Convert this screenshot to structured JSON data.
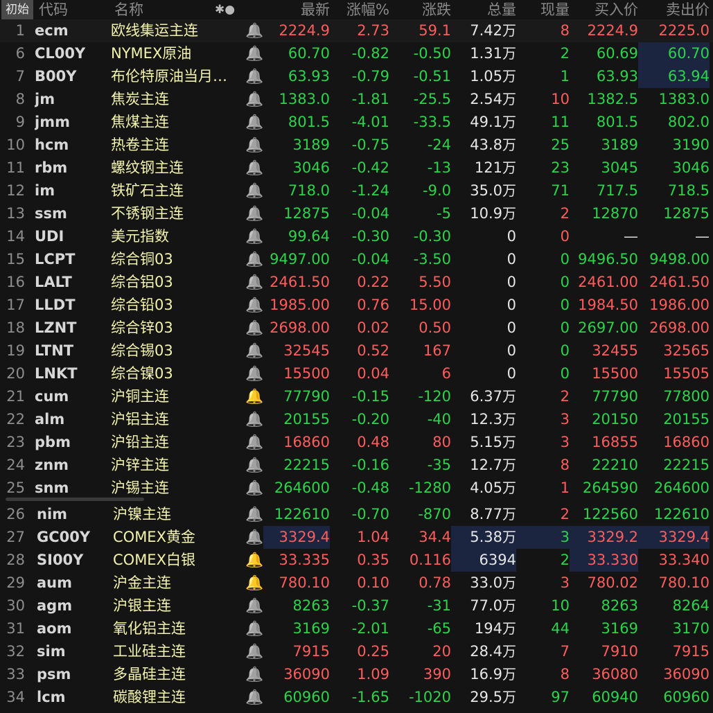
{
  "header": {
    "tag": "初始",
    "code": "代码",
    "name": "名称",
    "settings_glyph": "✱●",
    "latest": "最新",
    "change_pct": "涨幅%",
    "change": "涨跌",
    "total_vol": "总量",
    "cur_vol": "现量",
    "bid": "买入价",
    "ask": "卖出价"
  },
  "rows": [
    {
      "no": "1",
      "code": "ecm",
      "name": "欧线集运主连",
      "bell": false,
      "latest": "2224.9",
      "pct": "2.73",
      "chg": "59.1",
      "vol": "7.42",
      "unit": "万",
      "cur": "8",
      "bid": "2224.9",
      "ask": "2225.0",
      "dir": "up",
      "cur_dir": "up",
      "bid_dir": "up",
      "ask_dir": "up"
    },
    {
      "no": "6",
      "code": "CL00Y",
      "name": "NYMEX原油",
      "bell": false,
      "latest": "60.70",
      "pct": "-0.82",
      "chg": "-0.50",
      "vol": "1.31",
      "unit": "万",
      "cur": "2",
      "bid": "60.69",
      "ask": "60.70",
      "dir": "dn",
      "cur_dir": "dn",
      "bid_dir": "dn",
      "ask_dir": "dn",
      "hl_ask": true
    },
    {
      "no": "7",
      "code": "B00Y",
      "name": "布伦特原油当月…",
      "bell": false,
      "latest": "63.93",
      "pct": "-0.79",
      "chg": "-0.51",
      "vol": "1.05",
      "unit": "万",
      "cur": "1",
      "bid": "63.93",
      "ask": "63.94",
      "dir": "dn",
      "cur_dir": "dn",
      "bid_dir": "dn",
      "ask_dir": "dn",
      "hl_ask": true
    },
    {
      "no": "8",
      "code": "jm",
      "name": "焦炭主连",
      "bell": false,
      "latest": "1383.0",
      "pct": "-1.81",
      "chg": "-25.5",
      "vol": "2.54",
      "unit": "万",
      "cur": "10",
      "bid": "1382.5",
      "ask": "1383.0",
      "dir": "dn",
      "cur_dir": "up",
      "bid_dir": "dn",
      "ask_dir": "dn"
    },
    {
      "no": "9",
      "code": "jmm",
      "name": "焦煤主连",
      "bell": false,
      "latest": "801.5",
      "pct": "-4.01",
      "chg": "-33.5",
      "vol": "49.1",
      "unit": "万",
      "cur": "11",
      "bid": "801.5",
      "ask": "802.0",
      "dir": "dn",
      "cur_dir": "dn",
      "bid_dir": "dn",
      "ask_dir": "dn"
    },
    {
      "no": "10",
      "code": "hcm",
      "name": "热卷主连",
      "bell": false,
      "latest": "3189",
      "pct": "-0.75",
      "chg": "-24",
      "vol": "43.8",
      "unit": "万",
      "cur": "25",
      "bid": "3189",
      "ask": "3190",
      "dir": "dn",
      "cur_dir": "dn",
      "bid_dir": "dn",
      "ask_dir": "dn"
    },
    {
      "no": "11",
      "code": "rbm",
      "name": "螺纹钢主连",
      "bell": false,
      "latest": "3046",
      "pct": "-0.42",
      "chg": "-13",
      "vol": "121",
      "unit": "万",
      "cur": "23",
      "bid": "3045",
      "ask": "3046",
      "dir": "dn",
      "cur_dir": "dn",
      "bid_dir": "dn",
      "ask_dir": "dn"
    },
    {
      "no": "12",
      "code": "im",
      "name": "铁矿石主连",
      "bell": false,
      "latest": "718.0",
      "pct": "-1.24",
      "chg": "-9.0",
      "vol": "35.0",
      "unit": "万",
      "cur": "71",
      "bid": "717.5",
      "ask": "718.5",
      "dir": "dn",
      "cur_dir": "dn",
      "bid_dir": "dn",
      "ask_dir": "dn"
    },
    {
      "no": "13",
      "code": "ssm",
      "name": "不锈钢主连",
      "bell": false,
      "latest": "12875",
      "pct": "-0.04",
      "chg": "-5",
      "vol": "10.9",
      "unit": "万",
      "cur": "2",
      "bid": "12870",
      "ask": "12875",
      "dir": "dn",
      "cur_dir": "up",
      "bid_dir": "dn",
      "ask_dir": "dn"
    },
    {
      "no": "14",
      "code": "UDI",
      "name": "美元指数",
      "bell": false,
      "latest": "99.64",
      "pct": "-0.30",
      "chg": "-0.30",
      "vol": "0",
      "unit": "",
      "cur": "0",
      "bid": "—",
      "ask": "—",
      "dir": "dn",
      "cur_dir": "up",
      "bid_dir": "neu",
      "ask_dir": "neu"
    },
    {
      "no": "15",
      "code": "LCPT",
      "name": "综合铜03",
      "bell": false,
      "latest": "9497.00",
      "pct": "-0.04",
      "chg": "-3.50",
      "vol": "0",
      "unit": "",
      "cur": "0",
      "bid": "9496.50",
      "ask": "9498.00",
      "dir": "dn",
      "cur_dir": "dn",
      "bid_dir": "dn",
      "ask_dir": "dn"
    },
    {
      "no": "16",
      "code": "LALT",
      "name": "综合铝03",
      "bell": false,
      "latest": "2461.50",
      "pct": "0.22",
      "chg": "5.50",
      "vol": "0",
      "unit": "",
      "cur": "0",
      "bid": "2461.00",
      "ask": "2461.50",
      "dir": "up",
      "cur_dir": "dn",
      "bid_dir": "up",
      "ask_dir": "up"
    },
    {
      "no": "17",
      "code": "LLDT",
      "name": "综合铅03",
      "bell": false,
      "latest": "1985.00",
      "pct": "0.76",
      "chg": "15.00",
      "vol": "0",
      "unit": "",
      "cur": "0",
      "bid": "1984.50",
      "ask": "1986.00",
      "dir": "up",
      "cur_dir": "dn",
      "bid_dir": "up",
      "ask_dir": "up"
    },
    {
      "no": "18",
      "code": "LZNT",
      "name": "综合锌03",
      "bell": false,
      "latest": "2698.00",
      "pct": "0.02",
      "chg": "0.50",
      "vol": "0",
      "unit": "",
      "cur": "0",
      "bid": "2697.00",
      "ask": "2698.00",
      "dir": "up",
      "cur_dir": "dn",
      "bid_dir": "dn",
      "ask_dir": "up"
    },
    {
      "no": "19",
      "code": "LTNT",
      "name": "综合锡03",
      "bell": false,
      "latest": "32545",
      "pct": "0.52",
      "chg": "167",
      "vol": "0",
      "unit": "",
      "cur": "0",
      "bid": "32455",
      "ask": "32565",
      "dir": "up",
      "cur_dir": "dn",
      "bid_dir": "up",
      "ask_dir": "up"
    },
    {
      "no": "20",
      "code": "LNKT",
      "name": "综合镍03",
      "bell": false,
      "latest": "15500",
      "pct": "0.04",
      "chg": "6",
      "vol": "0",
      "unit": "",
      "cur": "0",
      "bid": "15500",
      "ask": "15505",
      "dir": "up",
      "cur_dir": "dn",
      "bid_dir": "up",
      "ask_dir": "up"
    },
    {
      "no": "21",
      "code": "cum",
      "name": "沪铜主连",
      "bell": true,
      "latest": "77790",
      "pct": "-0.15",
      "chg": "-120",
      "vol": "6.37",
      "unit": "万",
      "cur": "2",
      "bid": "77790",
      "ask": "77800",
      "dir": "dn",
      "cur_dir": "up",
      "bid_dir": "dn",
      "ask_dir": "dn"
    },
    {
      "no": "22",
      "code": "alm",
      "name": "沪铝主连",
      "bell": false,
      "latest": "20155",
      "pct": "-0.20",
      "chg": "-40",
      "vol": "12.3",
      "unit": "万",
      "cur": "3",
      "bid": "20150",
      "ask": "20155",
      "dir": "dn",
      "cur_dir": "up",
      "bid_dir": "dn",
      "ask_dir": "dn"
    },
    {
      "no": "23",
      "code": "pbm",
      "name": "沪铅主连",
      "bell": false,
      "latest": "16860",
      "pct": "0.48",
      "chg": "80",
      "vol": "5.15",
      "unit": "万",
      "cur": "3",
      "bid": "16855",
      "ask": "16860",
      "dir": "up",
      "cur_dir": "up",
      "bid_dir": "up",
      "ask_dir": "up"
    },
    {
      "no": "24",
      "code": "znm",
      "name": "沪锌主连",
      "bell": false,
      "latest": "22215",
      "pct": "-0.16",
      "chg": "-35",
      "vol": "12.7",
      "unit": "万",
      "cur": "8",
      "bid": "22210",
      "ask": "22215",
      "dir": "dn",
      "cur_dir": "up",
      "bid_dir": "dn",
      "ask_dir": "dn"
    },
    {
      "no": "25",
      "code": "snm",
      "name": "沪锡主连",
      "bell": false,
      "latest": "264600",
      "pct": "-0.48",
      "chg": "-1280",
      "vol": "4.05",
      "unit": "万",
      "cur": "1",
      "bid": "264590",
      "ask": "264600",
      "dir": "dn",
      "cur_dir": "up",
      "bid_dir": "dn",
      "ask_dir": "dn"
    },
    {
      "no": "26",
      "code": "nim",
      "name": "沪镍主连",
      "bell": false,
      "latest": "122610",
      "pct": "-0.70",
      "chg": "-870",
      "vol": "8.77",
      "unit": "万",
      "cur": "2",
      "bid": "122560",
      "ask": "122610",
      "dir": "dn",
      "cur_dir": "up",
      "bid_dir": "dn",
      "ask_dir": "dn"
    },
    {
      "no": "27",
      "code": "GC00Y",
      "name": "COMEX黄金",
      "bell": false,
      "latest": "3329.4",
      "pct": "1.04",
      "chg": "34.4",
      "vol": "5.38",
      "unit": "万",
      "cur": "3",
      "bid": "3329.2",
      "ask": "3329.4",
      "dir": "up",
      "cur_dir": "dn",
      "bid_dir": "up",
      "ask_dir": "up",
      "hl_latest": true,
      "hl_vol": true,
      "hl_cur": true,
      "hl_bid": true,
      "hl_ask": true
    },
    {
      "no": "28",
      "code": "SI00Y",
      "name": "COMEX白银",
      "bell": true,
      "latest": "33.335",
      "pct": "0.35",
      "chg": "0.116",
      "vol": "6394",
      "unit": "",
      "cur": "2",
      "bid": "33.330",
      "ask": "33.340",
      "dir": "up",
      "cur_dir": "dn",
      "bid_dir": "up",
      "ask_dir": "up",
      "hl_vol": true,
      "hl_bid": true
    },
    {
      "no": "29",
      "code": "aum",
      "name": "沪金主连",
      "bell": true,
      "latest": "780.10",
      "pct": "0.10",
      "chg": "0.78",
      "vol": "33.0",
      "unit": "万",
      "cur": "3",
      "bid": "780.02",
      "ask": "780.10",
      "dir": "up",
      "cur_dir": "up",
      "bid_dir": "up",
      "ask_dir": "up"
    },
    {
      "no": "30",
      "code": "agm",
      "name": "沪银主连",
      "bell": false,
      "latest": "8263",
      "pct": "-0.37",
      "chg": "-31",
      "vol": "77.0",
      "unit": "万",
      "cur": "10",
      "bid": "8263",
      "ask": "8264",
      "dir": "dn",
      "cur_dir": "dn",
      "bid_dir": "dn",
      "ask_dir": "dn"
    },
    {
      "no": "31",
      "code": "aom",
      "name": "氧化铝主连",
      "bell": false,
      "latest": "3169",
      "pct": "-2.01",
      "chg": "-65",
      "vol": "194",
      "unit": "万",
      "cur": "44",
      "bid": "3169",
      "ask": "3170",
      "dir": "dn",
      "cur_dir": "dn",
      "bid_dir": "dn",
      "ask_dir": "dn"
    },
    {
      "no": "32",
      "code": "sim",
      "name": "工业硅主连",
      "bell": false,
      "latest": "7915",
      "pct": "0.25",
      "chg": "20",
      "vol": "28.4",
      "unit": "万",
      "cur": "7",
      "bid": "7910",
      "ask": "7915",
      "dir": "up",
      "cur_dir": "up",
      "bid_dir": "up",
      "ask_dir": "up"
    },
    {
      "no": "33",
      "code": "psm",
      "name": "多晶硅主连",
      "bell": false,
      "latest": "36090",
      "pct": "1.09",
      "chg": "390",
      "vol": "16.9",
      "unit": "万",
      "cur": "8",
      "bid": "36080",
      "ask": "36090",
      "dir": "up",
      "cur_dir": "up",
      "bid_dir": "up",
      "ask_dir": "up"
    },
    {
      "no": "34",
      "code": "lcm",
      "name": "碳酸锂主连",
      "bell": false,
      "latest": "60960",
      "pct": "-1.65",
      "chg": "-1020",
      "vol": "29.5",
      "unit": "万",
      "cur": "97",
      "bid": "60940",
      "ask": "60960",
      "dir": "dn",
      "cur_dir": "dn",
      "bid_dir": "dn",
      "ask_dir": "dn"
    }
  ]
}
